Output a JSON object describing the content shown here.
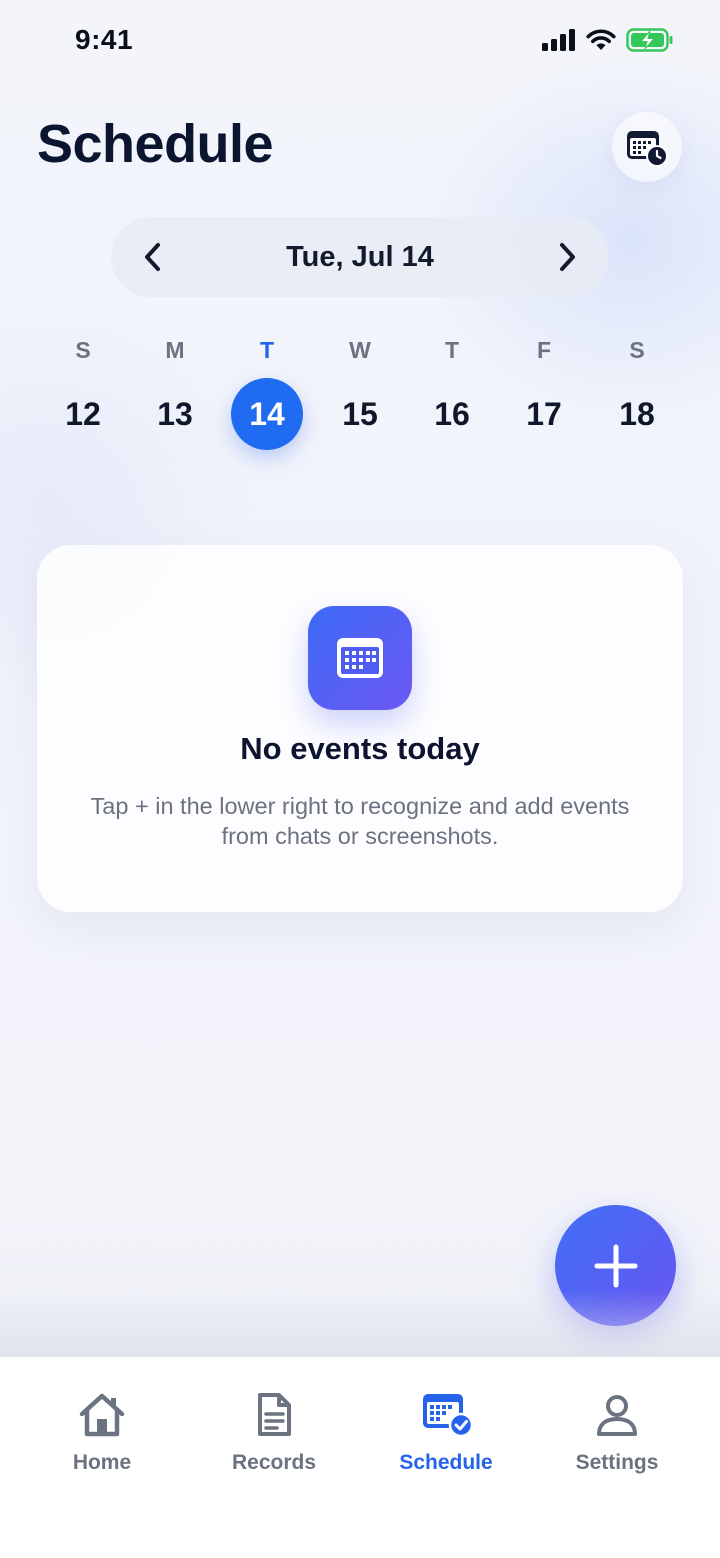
{
  "status_bar": {
    "time": "9:41",
    "icons": [
      "cellular-signal-icon",
      "wifi-icon",
      "battery-charging-icon"
    ]
  },
  "header": {
    "title": "Schedule",
    "calendar_button_icon": "calendar-clock-icon"
  },
  "date_nav": {
    "label": "Tue, Jul 14",
    "prev_icon": "chevron-left-icon",
    "next_icon": "chevron-right-icon"
  },
  "week": {
    "days": [
      {
        "letter": "S",
        "number": "12",
        "selected": false
      },
      {
        "letter": "M",
        "number": "13",
        "selected": false
      },
      {
        "letter": "T",
        "number": "14",
        "selected": true
      },
      {
        "letter": "W",
        "number": "15",
        "selected": false
      },
      {
        "letter": "T",
        "number": "16",
        "selected": false
      },
      {
        "letter": "F",
        "number": "17",
        "selected": false
      },
      {
        "letter": "S",
        "number": "18",
        "selected": false
      }
    ]
  },
  "empty_state": {
    "icon": "calendar-icon",
    "title": "No events today",
    "description": "Tap + in the lower right to recognize and add events from chats or screenshots."
  },
  "fab": {
    "icon": "plus-icon"
  },
  "tab_bar": {
    "items": [
      {
        "label": "Home",
        "icon": "home-icon",
        "active": false
      },
      {
        "label": "Records",
        "icon": "document-icon",
        "active": false
      },
      {
        "label": "Schedule",
        "icon": "calendar-check-icon",
        "active": true
      },
      {
        "label": "Settings",
        "icon": "user-icon",
        "active": false
      }
    ]
  },
  "colors": {
    "accent": "#1f6bf2",
    "gradient_start": "#3d6af6",
    "gradient_end": "#6c58f4",
    "battery": "#34c759",
    "text_primary": "#0c1530",
    "text_secondary": "#6b7280"
  }
}
